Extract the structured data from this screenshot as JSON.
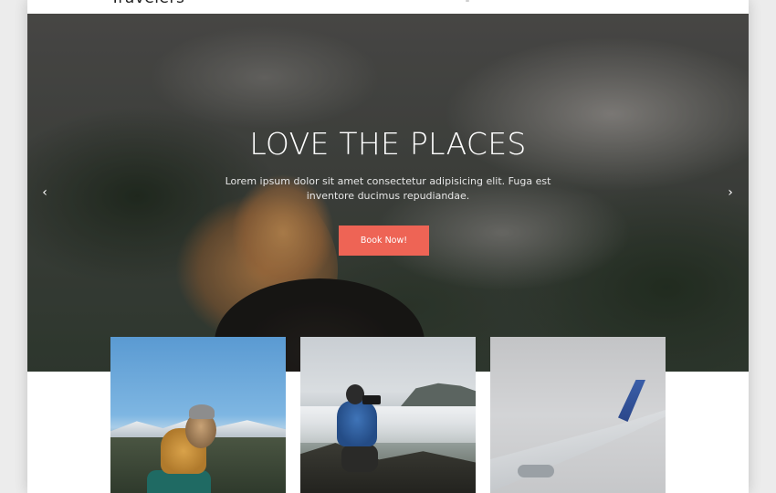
{
  "brand": {
    "logo_text": "Travelers"
  },
  "hero": {
    "title": "LOVE THE PLACES",
    "subtitle": "Lorem ipsum dolor sit amet consectetur adipisicing elit. Fuga est inventore ducimus repudiandae.",
    "cta_label": "Book Now!",
    "cta_color": "#ee6455",
    "prev_arrow": "‹",
    "next_arrow": "›",
    "prev_icon": "chevron-left-icon",
    "next_icon": "chevron-right-icon"
  },
  "cards": [
    {
      "image": "hiker-mountain-photo"
    },
    {
      "image": "photographer-cliff-photo"
    },
    {
      "image": "airplane-wing-photo"
    }
  ]
}
